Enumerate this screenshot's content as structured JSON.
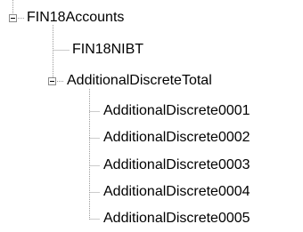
{
  "tree": {
    "root": {
      "label": "FIN18Accounts",
      "expanded": true,
      "children": [
        {
          "label": "FIN18NIBT"
        },
        {
          "label": "AdditionalDiscreteTotal",
          "expanded": true,
          "children": [
            {
              "label": "AdditionalDiscrete0001"
            },
            {
              "label": "AdditionalDiscrete0002"
            },
            {
              "label": "AdditionalDiscrete0003"
            },
            {
              "label": "AdditionalDiscrete0004"
            },
            {
              "label": "AdditionalDiscrete0005"
            }
          ]
        }
      ]
    }
  },
  "colors": {
    "connector": "#9a9a9a",
    "toggle_border": "#8c8c8c",
    "text": "#000000"
  },
  "icons": {
    "expanded_toggle": "collapse-minus-icon"
  }
}
